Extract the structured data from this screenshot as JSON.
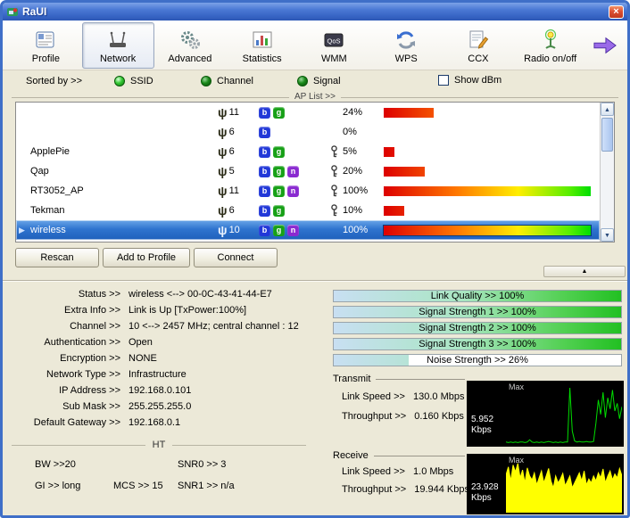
{
  "window": {
    "title": "RaUI",
    "close_glyph": "×"
  },
  "toolbar": {
    "items": [
      {
        "label": "Profile",
        "active": false
      },
      {
        "label": "Network",
        "active": true
      },
      {
        "label": "Advanced",
        "active": false
      },
      {
        "label": "Statistics",
        "active": false
      },
      {
        "label": "WMM",
        "active": false,
        "icon_text": "QoS"
      },
      {
        "label": "WPS",
        "active": false
      },
      {
        "label": "CCX",
        "active": false
      },
      {
        "label": "Radio on/off",
        "active": false
      }
    ]
  },
  "sort_bar": {
    "label": "Sorted by >>",
    "buttons": [
      "SSID",
      "Channel",
      "Signal"
    ],
    "show_dbm": "Show dBm"
  },
  "ap_list": {
    "divider_label": "AP List >>",
    "rows": [
      {
        "ssid": "",
        "channel": "11",
        "modes": [
          "b",
          "g"
        ],
        "secured": false,
        "signal": "24%",
        "signal_value": 24,
        "selected": false
      },
      {
        "ssid": "",
        "channel": "6",
        "modes": [
          "b"
        ],
        "secured": false,
        "signal": "0%",
        "signal_value": 0,
        "selected": false
      },
      {
        "ssid": "ApplePie",
        "channel": "6",
        "modes": [
          "b",
          "g"
        ],
        "secured": true,
        "signal": "5%",
        "signal_value": 5,
        "selected": false
      },
      {
        "ssid": "Qap",
        "channel": "5",
        "modes": [
          "b",
          "g",
          "n"
        ],
        "secured": true,
        "signal": "20%",
        "signal_value": 20,
        "selected": false
      },
      {
        "ssid": "RT3052_AP",
        "channel": "11",
        "modes": [
          "b",
          "g",
          "n"
        ],
        "secured": true,
        "signal": "100%",
        "signal_value": 100,
        "selected": false
      },
      {
        "ssid": "Tekman",
        "channel": "6",
        "modes": [
          "b",
          "g"
        ],
        "secured": true,
        "signal": "10%",
        "signal_value": 10,
        "selected": false
      },
      {
        "ssid": "wireless",
        "channel": "10",
        "modes": [
          "b",
          "g",
          "n"
        ],
        "secured": false,
        "signal": "100%",
        "signal_value": 100,
        "selected": true
      }
    ],
    "actions": [
      "Rescan",
      "Add to Profile",
      "Connect"
    ],
    "collapse_glyph": "▲"
  },
  "status": {
    "fields": [
      {
        "label": "Status >>",
        "value": "wireless <--> 00-0C-43-41-44-E7"
      },
      {
        "label": "Extra Info >>",
        "value": "Link is Up [TxPower:100%]"
      },
      {
        "label": "Channel >>",
        "value": "10 <--> 2457 MHz; central channel : 12"
      },
      {
        "label": "Authentication >>",
        "value": "Open"
      },
      {
        "label": "Encryption >>",
        "value": "NONE"
      },
      {
        "label": "Network Type >>",
        "value": "Infrastructure"
      },
      {
        "label": "IP Address >>",
        "value": "192.168.0.101"
      },
      {
        "label": "Sub Mask >>",
        "value": "255.255.255.0"
      },
      {
        "label": "Default Gateway >>",
        "value": "192.168.0.1"
      }
    ],
    "ht": {
      "title": "HT",
      "row1": [
        "BW >>20",
        "SNR0 >> 3"
      ],
      "row2": [
        "GI >> long",
        "MCS >> 15",
        "SNR1 >> n/a"
      ]
    },
    "quality_bars": [
      {
        "label": "Link Quality >> 100%",
        "value": 100
      },
      {
        "label": "Signal Strength 1 >> 100%",
        "value": 100
      },
      {
        "label": "Signal Strength 2 >> 100%",
        "value": 100
      },
      {
        "label": "Signal Strength 3 >> 100%",
        "value": 100
      },
      {
        "label": "Noise Strength >> 26%",
        "value": 26
      }
    ],
    "transmit": {
      "section_label": "Transmit",
      "link_speed_label": "Link Speed >>",
      "link_speed_value": "130.0 Mbps",
      "throughput_label": "Throughput >>",
      "throughput_value": "0.160 Kbps",
      "max_label": "Max",
      "peak_value": "5.952",
      "peak_unit": "Kbps",
      "spark": [
        2,
        1,
        2,
        1,
        2,
        1,
        2,
        2,
        1,
        2,
        6,
        2,
        1,
        2,
        1,
        2,
        1,
        2,
        3,
        2,
        1,
        2,
        1,
        2,
        1,
        2,
        2,
        100,
        22,
        4,
        2,
        3,
        2,
        2,
        3,
        2,
        2,
        3,
        36,
        78,
        52,
        92,
        46,
        82,
        62,
        96,
        58,
        72,
        44,
        66
      ]
    },
    "receive": {
      "section_label": "Receive",
      "link_speed_label": "Link Speed >>",
      "link_speed_value": "1.0 Mbps",
      "throughput_label": "Throughput >>",
      "throughput_value": "19.944 Kbps",
      "max_label": "Max",
      "peak_value": "23.928",
      "peak_unit": "Kbps",
      "spark": [
        72,
        88,
        60,
        92,
        78,
        95,
        66,
        82,
        56,
        86,
        70,
        62,
        76,
        52,
        66,
        80,
        56,
        70,
        85,
        60,
        46,
        70,
        56,
        64,
        75,
        50,
        60,
        70,
        46,
        56,
        66,
        76,
        60,
        80,
        52,
        64,
        56,
        70,
        60,
        76,
        66,
        84,
        56,
        70,
        80,
        62,
        74,
        66,
        85,
        70
      ]
    }
  },
  "colors": {
    "titlebar": "#4a78d4",
    "selection": "#2f74cf",
    "signal_gradient": [
      "#dd0000",
      "#ff7700",
      "#ffee00",
      "#00dd00"
    ],
    "quality_gradient": [
      "#c8dff2",
      "#a9e6c2",
      "#22c022"
    ],
    "transmit_plot": "#00dd00",
    "receive_plot": "#ffff00",
    "led_green": "#35c935"
  }
}
